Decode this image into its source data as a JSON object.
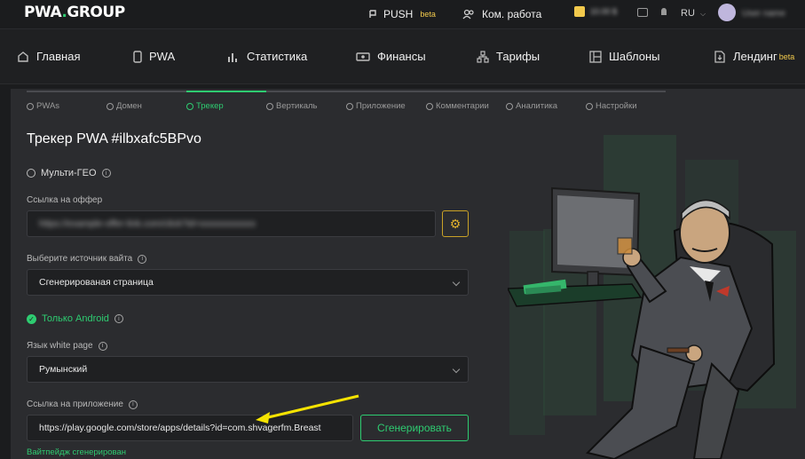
{
  "brand": {
    "logo_main": "PWA",
    "logo_dot": ".",
    "logo_group": "GROUP"
  },
  "topbar": {
    "push_label": "PUSH",
    "push_badge": "beta",
    "team_label": "Ком. работа",
    "balance": "10.00 $",
    "language": "RU",
    "username": "User name"
  },
  "nav": {
    "items": [
      {
        "label": "Главная",
        "icon": "home-icon"
      },
      {
        "label": "PWA",
        "icon": "phone-icon"
      },
      {
        "label": "Статистика",
        "icon": "bar-chart-icon"
      },
      {
        "label": "Финансы",
        "icon": "money-icon"
      },
      {
        "label": "Тарифы",
        "icon": "sitemap-icon"
      },
      {
        "label": "Шаблоны",
        "icon": "template-icon"
      },
      {
        "label": "Лендинг",
        "icon": "landing-icon"
      }
    ],
    "landing_badge": "beta"
  },
  "steps": [
    {
      "label": "PWAs"
    },
    {
      "label": "Домен"
    },
    {
      "label": "Трекер"
    },
    {
      "label": "Вертикаль"
    },
    {
      "label": "Приложение"
    },
    {
      "label": "Комментарии"
    },
    {
      "label": "Аналитика"
    },
    {
      "label": "Настройки"
    }
  ],
  "active_step": "Трекер",
  "page": {
    "title": "Трекер PWA #ilbxafc5BPvo",
    "multigeo_label": "Мульти-ГЕО",
    "offer_label": "Ссылка на оффер",
    "offer_value": "https://example-offer-link.com/click?id=xxxxxxxxxxxx",
    "source_label": "Выберите источник вайта",
    "source_value": "Сгенерированая страница",
    "android_label": "Только Android",
    "lang_label": "Язык white page",
    "lang_value": "Румынский",
    "app_link_label": "Ссылка на приложение",
    "app_link_value": "https://play.google.com/store/apps/details?id=com.shvagerfm.Breast",
    "generate_button": "Сгенерировать",
    "status_text": "Вайтпейдж сгенерирован"
  },
  "colors": {
    "accent": "#2ecc71",
    "warning": "#e1b12c",
    "arrow": "#f5e300"
  }
}
